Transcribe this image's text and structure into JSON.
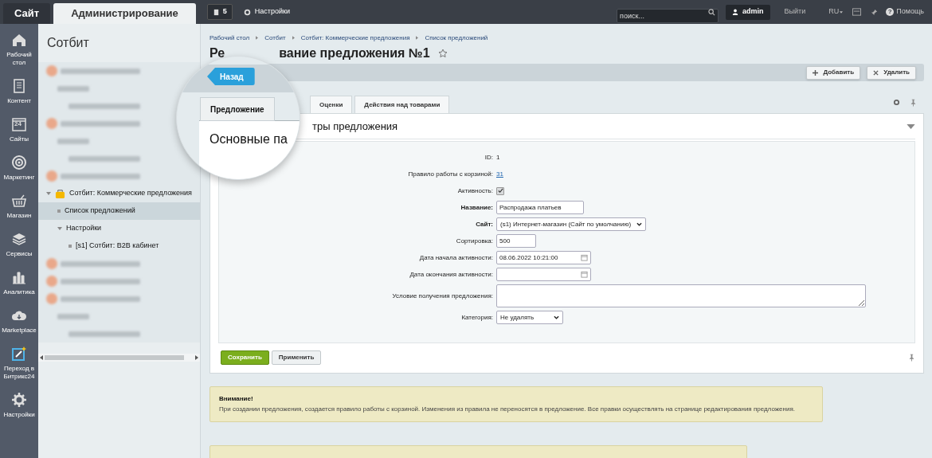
{
  "top_bar": {
    "tabs": [
      {
        "label": "Сайт",
        "selected": false
      },
      {
        "label": "Администрирование",
        "selected": true
      }
    ],
    "notifications": "5",
    "settings": "Настройки",
    "search": {
      "placeholder": "поиск..."
    },
    "user": "admin",
    "logout": "Выйти",
    "language": "RU",
    "help_icon": "?",
    "help": "Помощь"
  },
  "nav": [
    {
      "kind": "home",
      "label": "Рабочий стол"
    },
    {
      "kind": "doc",
      "label": "Контент"
    },
    {
      "kind": "calendar",
      "label": "Сайты",
      "badge": "24"
    },
    {
      "kind": "target",
      "label": "Маркетинг"
    },
    {
      "kind": "basket",
      "label": "Магазин"
    },
    {
      "kind": "layers",
      "label": "Сервисы"
    },
    {
      "kind": "chart",
      "label": "Аналитика"
    },
    {
      "kind": "cloud",
      "label": "Marketplace"
    },
    {
      "kind": "wand",
      "label": "Переход в Битрикс24"
    },
    {
      "kind": "gear",
      "label": "Настройки"
    }
  ],
  "sidebar": {
    "title": "Сотбит",
    "items": [
      {
        "kind": "blurred",
        "children": [
          {
            "kind": "blurred",
            "children": [
              {
                "kind": "blurred"
              }
            ]
          }
        ]
      },
      {
        "kind": "blurred",
        "children": [
          {
            "kind": "blurred",
            "children": [
              {
                "kind": "blurred"
              }
            ]
          }
        ]
      },
      {
        "kind": "blurred"
      },
      {
        "kind": "module",
        "label": "Сотбит: Коммерческие предложения",
        "expanded": true,
        "selected": false,
        "children": [
          {
            "kind": "page",
            "label": "Список предложений",
            "selected": true
          },
          {
            "kind": "folder",
            "label": "Настройки",
            "expanded": true,
            "selected": false,
            "children": [
              {
                "kind": "page",
                "label": "[s1] Сотбит: B2B кабинет",
                "selected": false
              }
            ]
          }
        ]
      },
      {
        "kind": "blurred"
      },
      {
        "kind": "blurred"
      },
      {
        "kind": "blurred",
        "children": [
          {
            "kind": "blurred",
            "children": [
              {
                "kind": "blurred"
              }
            ]
          }
        ]
      }
    ]
  },
  "breadcrumbs": [
    "Рабочий стол",
    "Сотбит",
    "Сотбит: Коммерческие предложения",
    "Список предложений"
  ],
  "title_parts": [
    "Ре",
    "вание предложения №1"
  ],
  "magnifier": {
    "back_button": "Назад",
    "tab": "Предложение",
    "heading": "Основные па"
  },
  "toolbar_buttons": [
    {
      "kind": "add",
      "label": "Добавить"
    },
    {
      "kind": "delete",
      "label": "Удалить"
    }
  ],
  "tabs": [
    {
      "label": "Оценки",
      "selected": false
    },
    {
      "label": "Действия над товарами",
      "selected": false
    }
  ],
  "section_heading": "тры предложения",
  "fields": [
    {
      "kind": "text",
      "label": "ID:",
      "value": "1",
      "required": false
    },
    {
      "kind": "link",
      "label": "Правило работы с корзиной:",
      "value": "31",
      "required": false
    },
    {
      "kind": "checkbox",
      "label": "Активность:",
      "checked": true,
      "required": false
    },
    {
      "kind": "input",
      "label": "Название:",
      "value": "Распродажа платьев",
      "required": true
    },
    {
      "kind": "select",
      "label": "Сайт:",
      "value": "(s1) Интернет-магазин (Сайт по умолчанию)",
      "required": true
    },
    {
      "kind": "short",
      "label": "Сортировка:",
      "value": "500",
      "required": false
    },
    {
      "kind": "date",
      "label": "Дата начала активности:",
      "value": "08.06.2022 10:21:00",
      "required": false
    },
    {
      "kind": "date",
      "label": "Дата окончания активности:",
      "required": false
    },
    {
      "kind": "textarea",
      "label": "Условие получения предложения:",
      "required": false
    },
    {
      "kind": "select_small",
      "label": "Категория:",
      "value": "Не удалять",
      "required": false
    }
  ],
  "actions": [
    {
      "kind": "primary",
      "label": "Сохранить"
    },
    {
      "kind": "secondary",
      "label": "Применить"
    }
  ],
  "notice": {
    "title": "Внимание!",
    "text": "При создании предложения, создается правило работы с корзиной. Изменения из правила не переносятся в предложение. Все правки осуществлять на странице редактирования предложения."
  }
}
